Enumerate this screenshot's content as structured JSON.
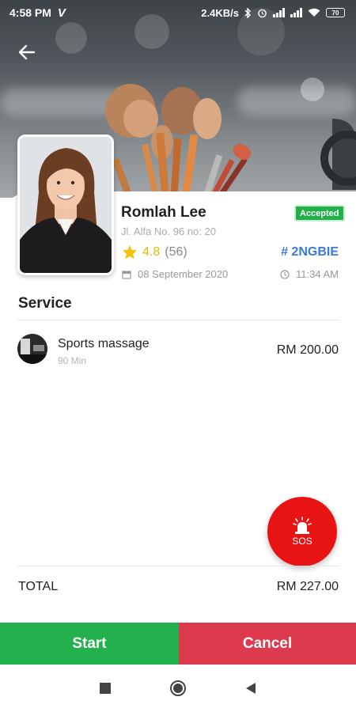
{
  "status_bar": {
    "time": "4:58 PM",
    "carrier_icon": "V",
    "speed": "2.4KB/s",
    "battery": "70"
  },
  "header": {
    "back_icon": "arrow-left-icon",
    "hero_image": "makeup-brushes-background"
  },
  "booking": {
    "customer_name": "Romlah Lee",
    "address": "Jl. Alfa No. 96 no: 20",
    "status": "Accepted",
    "status_color": "#22b04b",
    "rating": "4.8",
    "rating_count": "(56)",
    "booking_code": "# 2NGBIE",
    "date": "08 September 2020",
    "time": "11:34 AM"
  },
  "service_section": {
    "title": "Service",
    "items": [
      {
        "name": "Sports massage",
        "duration": "90 Min",
        "price": "RM 200.00"
      }
    ]
  },
  "sos": {
    "label": "SOS",
    "color": "#e81414"
  },
  "total": {
    "label": "TOTAL",
    "value": "RM 227.00"
  },
  "actions": {
    "start_label": "Start",
    "cancel_label": "Cancel",
    "start_color": "#23b14d",
    "cancel_color": "#dc3b4e"
  },
  "nav": {
    "icons": [
      "recent-apps-icon",
      "home-icon",
      "back-triangle-icon"
    ]
  }
}
